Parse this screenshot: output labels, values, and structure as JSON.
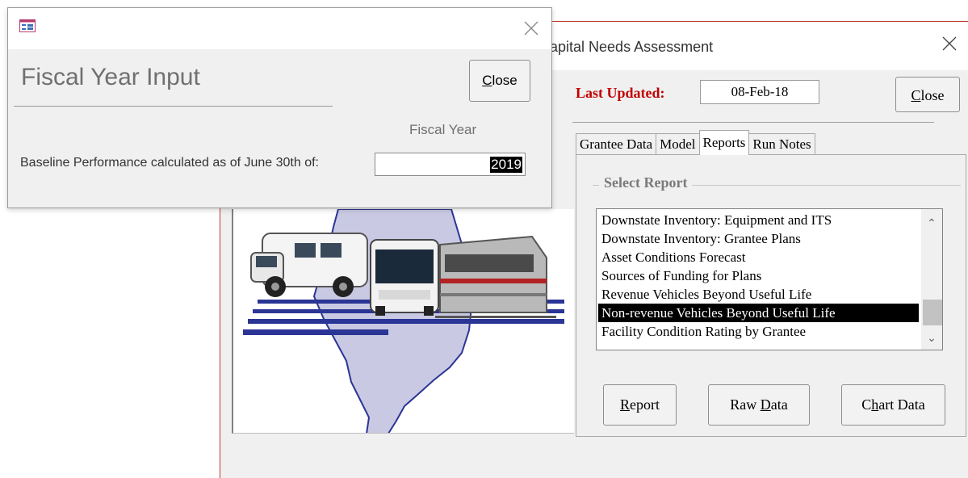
{
  "main_window": {
    "title": "apital Needs Assessment",
    "last_updated_label": "Last Updated:",
    "last_updated_value": "08-Feb-18",
    "close_button": {
      "accel": "C",
      "rest": "lose"
    }
  },
  "tabs": [
    {
      "label": "Grantee Data",
      "active": false
    },
    {
      "label": "Model",
      "active": false
    },
    {
      "label": "Reports",
      "active": true
    },
    {
      "label": "Run Notes",
      "active": false
    }
  ],
  "reports_tab": {
    "group_label": "Select Report",
    "report_list": [
      {
        "label": "Downstate Inventory: Equipment and ITS",
        "selected": false
      },
      {
        "label": "Downstate Inventory: Grantee Plans",
        "selected": false
      },
      {
        "label": "Asset Conditions Forecast",
        "selected": false
      },
      {
        "label": "Sources of Funding for Plans",
        "selected": false
      },
      {
        "label": "Revenue Vehicles Beyond Useful Life",
        "selected": false
      },
      {
        "label": "Non-revenue Vehicles Beyond Useful Life",
        "selected": true
      },
      {
        "label": "Facility Condition Rating by Grantee",
        "selected": false
      }
    ],
    "buttons": {
      "report": {
        "accel": "R",
        "rest": "eport"
      },
      "raw_data": {
        "pre": "Raw ",
        "accel": "D",
        "rest": "ata"
      },
      "chart_data": {
        "pre": "C",
        "accel": "h",
        "rest": "art Data"
      }
    }
  },
  "dialog": {
    "heading": "Fiscal Year Input",
    "close_button": {
      "accel": "C",
      "rest": "lose"
    },
    "column_label": "Fiscal Year",
    "baseline_label": "Baseline Performance calculated as of June 30th of:",
    "fiscal_year_value": "2019"
  },
  "icons": {
    "dialog_app": "form-icon",
    "dialog_close": "close-icon",
    "main_close": "close-icon",
    "scroll_up": "chevron-up-icon",
    "scroll_down": "chevron-down-icon"
  },
  "colors": {
    "last_updated_label": "#c00000",
    "selection_bg": "#000000",
    "window_border": "#c0392b",
    "logo_blue": "#2b3595",
    "illinois_fill": "#c9c9e3"
  }
}
